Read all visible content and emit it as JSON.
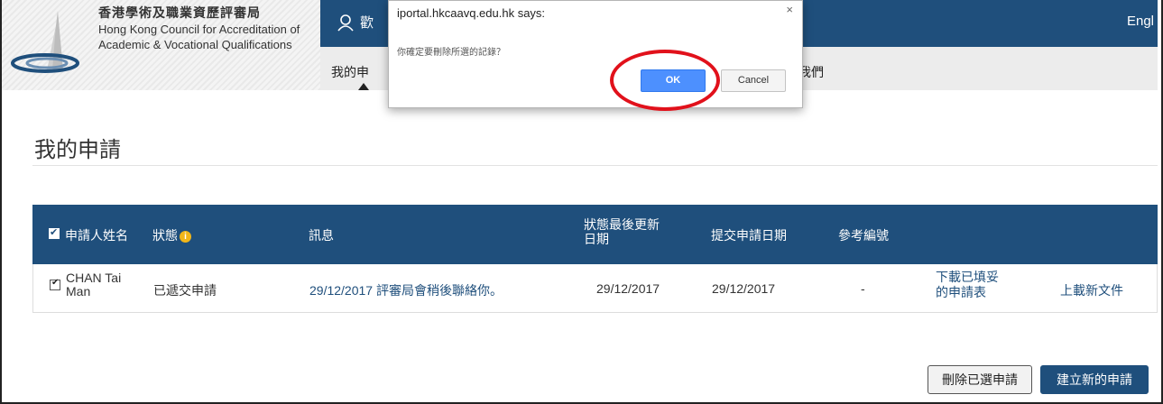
{
  "header": {
    "org_name_zh": "香港學術及職業資歷評審局",
    "org_name_en_1": "Hong Kong Council for Accreditation of",
    "org_name_en_2": "Academic & Vocational Qualifications",
    "welcome_text": "歡",
    "language_link": "Engl",
    "nav_item_1": "我的申",
    "nav_item_2": "我們"
  },
  "page": {
    "title": "我的申請"
  },
  "table": {
    "headers": {
      "applicant_name": "申請人姓名",
      "status": "狀態",
      "message": "訊息",
      "status_updated_1": "狀態最後更新",
      "status_updated_2": "日期",
      "submitted_date": "提交申請日期",
      "ref_no": "參考編號"
    },
    "rows": [
      {
        "name_1": "CHAN Tai",
        "name_2": "Man",
        "status": "已遞交申請",
        "message": "29/12/2017 評審局會稍後聯絡你。",
        "status_updated": "29/12/2017",
        "submitted": "29/12/2017",
        "ref_no": "-",
        "download_1": "下載已填妥",
        "download_2": "的申請表",
        "upload": "上載新文件"
      }
    ]
  },
  "actions": {
    "delete_selected": "刪除已選申請",
    "create_new": "建立新的申請"
  },
  "dialog": {
    "title": "iportal.hkcaavq.edu.hk says:",
    "close": "×",
    "message": "你確定要刪除所選的記錄？",
    "ok": "OK",
    "cancel": "Cancel"
  },
  "colors": {
    "brand_blue": "#1f4f7c",
    "highlight_red": "#e1111b",
    "ok_blue": "#4d90fe"
  }
}
